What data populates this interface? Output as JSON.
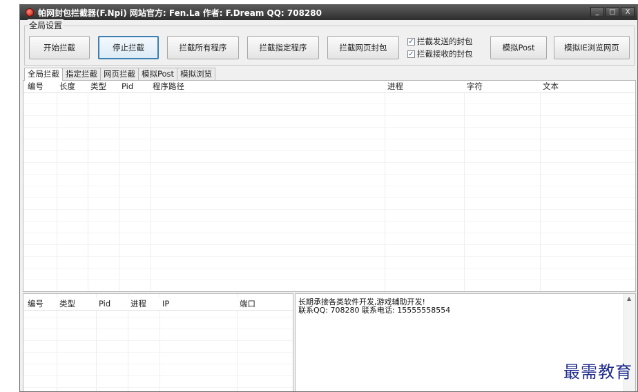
{
  "window": {
    "title": "帕网封包拦截器(F.Npi) 网站官方: Fen.La 作者: F.Dream QQ: 708280",
    "controls": [
      "_",
      "□",
      "X"
    ]
  },
  "global_settings": {
    "group_label": "全局设置",
    "buttons": [
      "开始拦截",
      "停止拦截",
      "拦截所有程序",
      "拦截指定程序",
      "拦截网页封包",
      "模拟Post",
      "模拟IE浏览网页"
    ],
    "checkboxes": [
      {
        "label": "拦截发送的封包",
        "checked": true
      },
      {
        "label": "拦截接收的封包",
        "checked": true
      }
    ]
  },
  "tabs": [
    "全局拦截",
    "指定拦截",
    "网页拦截",
    "模拟Post",
    "模拟浏览"
  ],
  "main_table": {
    "columns": [
      "编号",
      "长度",
      "类型",
      "Pid",
      "程序路径",
      "进程",
      "字符",
      "文本"
    ]
  },
  "conn_table": {
    "columns": [
      "编号",
      "类型",
      "Pid",
      "进程",
      "IP",
      "端口"
    ]
  },
  "log": {
    "lines": [
      "长期承接各类软件开发,游戏辅助开发!",
      "联系QQ: 708280 联系电话: 15555558554"
    ]
  },
  "watermark": "最需教育"
}
